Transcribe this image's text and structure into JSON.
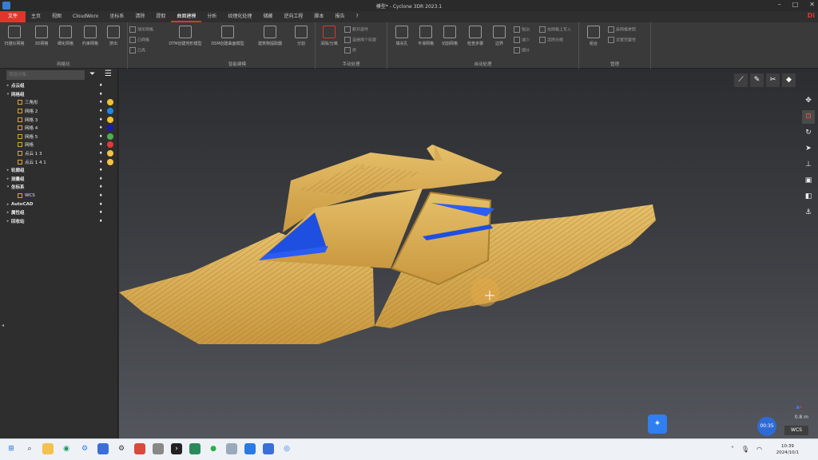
{
  "window": {
    "title": "模型* - Cyclone 3DR 2023.1",
    "brand": "Di"
  },
  "menu": [
    "文件",
    "主页",
    "视图",
    "CloudWorx",
    "坐标系",
    "清除",
    "提取",
    "曲面建模",
    "分析",
    "纹理化处理",
    "储藏",
    "逆向工程",
    "脚本",
    "报告",
    "?"
  ],
  "ribbon": {
    "groups": [
      {
        "label": "网格化"
      },
      {
        "label": "智能建模"
      },
      {
        "label": "手动处理"
      },
      {
        "label": "自动处理"
      },
      {
        "label": "管理"
      }
    ],
    "buttons": [
      "扫描仪网格",
      "3D网格",
      "细化网格",
      "约束网格",
      "挤出",
      "DTM创建地形模型",
      "DSM创建曲面模型",
      "建筑物提取器",
      "分割",
      "清除/分离",
      "填充孔",
      "平滑网格",
      "切割网格",
      "检查步骤",
      "边界",
      "组合"
    ],
    "small": [
      "球形网格",
      "凸网格",
      "凸壳",
      "断开部件",
      "连接两个轮廓",
      "桥",
      "锐边",
      "减少",
      "细分",
      "在网格上写入",
      "清除尖峰",
      "拆网格参照",
      "设置完整性"
    ]
  },
  "panel": {
    "filter_placeholder": "筛选对象...",
    "tree": [
      {
        "label": "点云组",
        "level": 0,
        "arrow": "▸"
      },
      {
        "label": "网格组",
        "level": 0,
        "arrow": "▾"
      },
      {
        "label": "三角形",
        "level": 1,
        "color": "#f1c232"
      },
      {
        "label": "网格 2",
        "level": 1,
        "color": "#1e88e5"
      },
      {
        "label": "网格 3",
        "level": 1,
        "color": "#f1c232"
      },
      {
        "label": "网格 4",
        "level": 1,
        "color": "#1a1ab8"
      },
      {
        "label": "网格 5",
        "level": 1,
        "color": "#4caf50"
      },
      {
        "label": "网格",
        "level": 1,
        "color": "#e53935"
      },
      {
        "label": "点云 1 3",
        "level": 1,
        "color": "#f6c244"
      },
      {
        "label": "点云 1 4 1",
        "level": 1,
        "color": "#f6c244"
      },
      {
        "label": "轮廓组",
        "level": 0,
        "arrow": "▸"
      },
      {
        "label": "测量组",
        "level": 0,
        "arrow": "▸"
      },
      {
        "label": "坐标系",
        "level": 0,
        "arrow": "▾"
      },
      {
        "label": "WCS",
        "level": 1
      },
      {
        "label": "AutoCAD",
        "level": 0,
        "arrow": "▸"
      },
      {
        "label": "属性组",
        "level": 0,
        "arrow": "▸"
      },
      {
        "label": "回收站",
        "level": 0,
        "arrow": "▸"
      }
    ]
  },
  "viewport": {
    "scale_text": "0.8 m",
    "wcs_label": "WCS",
    "time": "00:35"
  },
  "taskbar": {
    "time": "10:39",
    "date": "2024/10/1"
  }
}
